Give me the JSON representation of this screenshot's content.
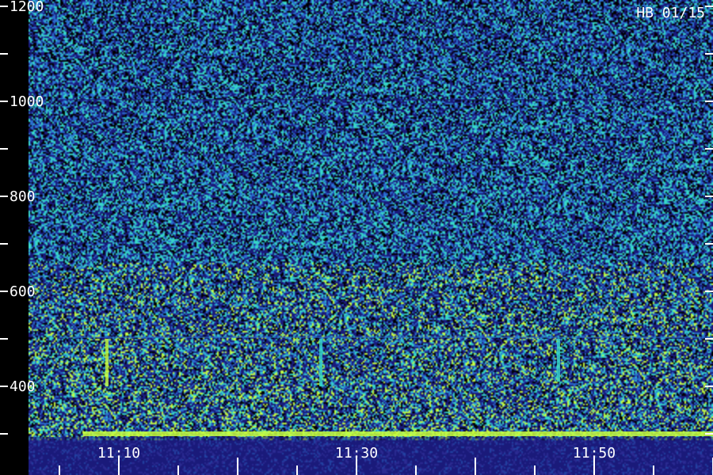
{
  "chart_data": {
    "type": "heatmap",
    "title": "HB 01/15",
    "xlabel": "",
    "ylabel": "",
    "x_ticks": [
      "11:10",
      "11:30",
      "11:50"
    ],
    "y_ticks": [
      400,
      600,
      800,
      1000,
      1200
    ],
    "ylim": [
      300,
      1200
    ],
    "xlim": [
      "11:05",
      "11:63"
    ],
    "grid": false,
    "colors": {
      "background": "#000000",
      "low": "#1a1a7a",
      "mid": "#2a6fd0",
      "high": "#36d6c8",
      "peak": "#c8ff40",
      "text": "#ffffff"
    },
    "features": [
      {
        "kind": "horizontal-band",
        "y": 300,
        "x_start": "11:07",
        "x_end": "11:63",
        "intensity": "high"
      },
      {
        "kind": "horizontal-band",
        "y": 500,
        "x_start": "11:05",
        "x_end": "11:63",
        "intensity": "mid"
      },
      {
        "kind": "horizontal-band",
        "y": 1000,
        "x_start": "11:05",
        "x_end": "11:63",
        "intensity": "low"
      },
      {
        "kind": "vertical-streak",
        "x": "11:09",
        "y_range": [
          400,
          500
        ],
        "intensity": "peak"
      },
      {
        "kind": "vertical-streak",
        "x": "11:27",
        "y_range": [
          400,
          500
        ],
        "intensity": "high"
      },
      {
        "kind": "vertical-streak",
        "x": "11:47",
        "y_range": [
          410,
          500
        ],
        "intensity": "high"
      }
    ]
  }
}
